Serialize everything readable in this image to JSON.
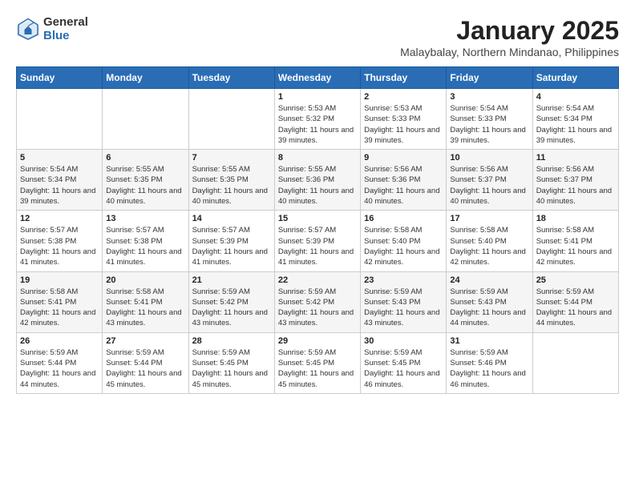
{
  "header": {
    "logo_general": "General",
    "logo_blue": "Blue",
    "title": "January 2025",
    "location": "Malaybalay, Northern Mindanao, Philippines"
  },
  "weekdays": [
    "Sunday",
    "Monday",
    "Tuesday",
    "Wednesday",
    "Thursday",
    "Friday",
    "Saturday"
  ],
  "weeks": [
    [
      {
        "day": "",
        "info": ""
      },
      {
        "day": "",
        "info": ""
      },
      {
        "day": "",
        "info": ""
      },
      {
        "day": "1",
        "info": "Sunrise: 5:53 AM\nSunset: 5:32 PM\nDaylight: 11 hours and 39 minutes."
      },
      {
        "day": "2",
        "info": "Sunrise: 5:53 AM\nSunset: 5:33 PM\nDaylight: 11 hours and 39 minutes."
      },
      {
        "day": "3",
        "info": "Sunrise: 5:54 AM\nSunset: 5:33 PM\nDaylight: 11 hours and 39 minutes."
      },
      {
        "day": "4",
        "info": "Sunrise: 5:54 AM\nSunset: 5:34 PM\nDaylight: 11 hours and 39 minutes."
      }
    ],
    [
      {
        "day": "5",
        "info": "Sunrise: 5:54 AM\nSunset: 5:34 PM\nDaylight: 11 hours and 39 minutes."
      },
      {
        "day": "6",
        "info": "Sunrise: 5:55 AM\nSunset: 5:35 PM\nDaylight: 11 hours and 40 minutes."
      },
      {
        "day": "7",
        "info": "Sunrise: 5:55 AM\nSunset: 5:35 PM\nDaylight: 11 hours and 40 minutes."
      },
      {
        "day": "8",
        "info": "Sunrise: 5:55 AM\nSunset: 5:36 PM\nDaylight: 11 hours and 40 minutes."
      },
      {
        "day": "9",
        "info": "Sunrise: 5:56 AM\nSunset: 5:36 PM\nDaylight: 11 hours and 40 minutes."
      },
      {
        "day": "10",
        "info": "Sunrise: 5:56 AM\nSunset: 5:37 PM\nDaylight: 11 hours and 40 minutes."
      },
      {
        "day": "11",
        "info": "Sunrise: 5:56 AM\nSunset: 5:37 PM\nDaylight: 11 hours and 40 minutes."
      }
    ],
    [
      {
        "day": "12",
        "info": "Sunrise: 5:57 AM\nSunset: 5:38 PM\nDaylight: 11 hours and 41 minutes."
      },
      {
        "day": "13",
        "info": "Sunrise: 5:57 AM\nSunset: 5:38 PM\nDaylight: 11 hours and 41 minutes."
      },
      {
        "day": "14",
        "info": "Sunrise: 5:57 AM\nSunset: 5:39 PM\nDaylight: 11 hours and 41 minutes."
      },
      {
        "day": "15",
        "info": "Sunrise: 5:57 AM\nSunset: 5:39 PM\nDaylight: 11 hours and 41 minutes."
      },
      {
        "day": "16",
        "info": "Sunrise: 5:58 AM\nSunset: 5:40 PM\nDaylight: 11 hours and 42 minutes."
      },
      {
        "day": "17",
        "info": "Sunrise: 5:58 AM\nSunset: 5:40 PM\nDaylight: 11 hours and 42 minutes."
      },
      {
        "day": "18",
        "info": "Sunrise: 5:58 AM\nSunset: 5:41 PM\nDaylight: 11 hours and 42 minutes."
      }
    ],
    [
      {
        "day": "19",
        "info": "Sunrise: 5:58 AM\nSunset: 5:41 PM\nDaylight: 11 hours and 42 minutes."
      },
      {
        "day": "20",
        "info": "Sunrise: 5:58 AM\nSunset: 5:41 PM\nDaylight: 11 hours and 43 minutes."
      },
      {
        "day": "21",
        "info": "Sunrise: 5:59 AM\nSunset: 5:42 PM\nDaylight: 11 hours and 43 minutes."
      },
      {
        "day": "22",
        "info": "Sunrise: 5:59 AM\nSunset: 5:42 PM\nDaylight: 11 hours and 43 minutes."
      },
      {
        "day": "23",
        "info": "Sunrise: 5:59 AM\nSunset: 5:43 PM\nDaylight: 11 hours and 43 minutes."
      },
      {
        "day": "24",
        "info": "Sunrise: 5:59 AM\nSunset: 5:43 PM\nDaylight: 11 hours and 44 minutes."
      },
      {
        "day": "25",
        "info": "Sunrise: 5:59 AM\nSunset: 5:44 PM\nDaylight: 11 hours and 44 minutes."
      }
    ],
    [
      {
        "day": "26",
        "info": "Sunrise: 5:59 AM\nSunset: 5:44 PM\nDaylight: 11 hours and 44 minutes."
      },
      {
        "day": "27",
        "info": "Sunrise: 5:59 AM\nSunset: 5:44 PM\nDaylight: 11 hours and 45 minutes."
      },
      {
        "day": "28",
        "info": "Sunrise: 5:59 AM\nSunset: 5:45 PM\nDaylight: 11 hours and 45 minutes."
      },
      {
        "day": "29",
        "info": "Sunrise: 5:59 AM\nSunset: 5:45 PM\nDaylight: 11 hours and 45 minutes."
      },
      {
        "day": "30",
        "info": "Sunrise: 5:59 AM\nSunset: 5:45 PM\nDaylight: 11 hours and 46 minutes."
      },
      {
        "day": "31",
        "info": "Sunrise: 5:59 AM\nSunset: 5:46 PM\nDaylight: 11 hours and 46 minutes."
      },
      {
        "day": "",
        "info": ""
      }
    ]
  ]
}
